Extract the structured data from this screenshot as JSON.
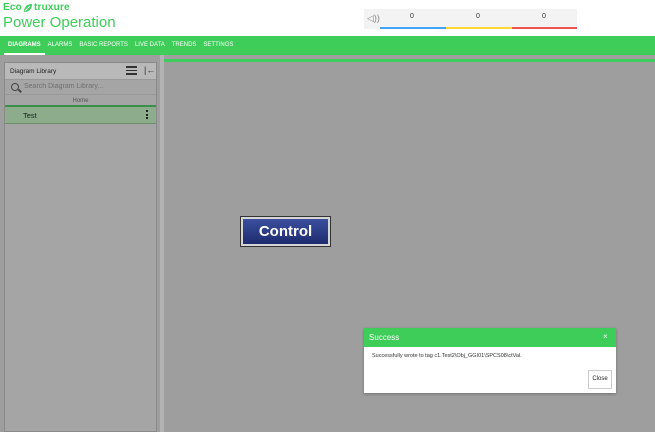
{
  "brand": {
    "logo_text": "EcoStruxure",
    "logo_prefix": "Eco",
    "logo_suffix": "truxure",
    "app_title": "Power Operation"
  },
  "alarm_counts": {
    "speaker_icon": "speaker-icon",
    "low": "0",
    "medium": "0",
    "high": "0",
    "colors": {
      "low": "#42a5f5",
      "medium": "#fdd835",
      "high": "#ef5350"
    }
  },
  "nav": {
    "items": [
      "DIAGRAMS",
      "ALARMS",
      "BASIC REPORTS",
      "LIVE DATA",
      "TRENDS",
      "SETTINGS"
    ],
    "active": "DIAGRAMS"
  },
  "library": {
    "title": "Diagram Library",
    "search_placeholder": "Search Diagram Library...",
    "home_label": "Home",
    "items": [
      {
        "label": "Test"
      }
    ]
  },
  "canvas": {
    "control_label": "Control"
  },
  "toast": {
    "title": "Success",
    "close_x": "×",
    "message": "Successfully wrote to tag c1.Test2\\Obj_GGI01\\SPCS08\\ctVal.",
    "button_label": "Close"
  },
  "colors": {
    "accent": "#3dcd58",
    "control_button": "#2a3a84"
  }
}
